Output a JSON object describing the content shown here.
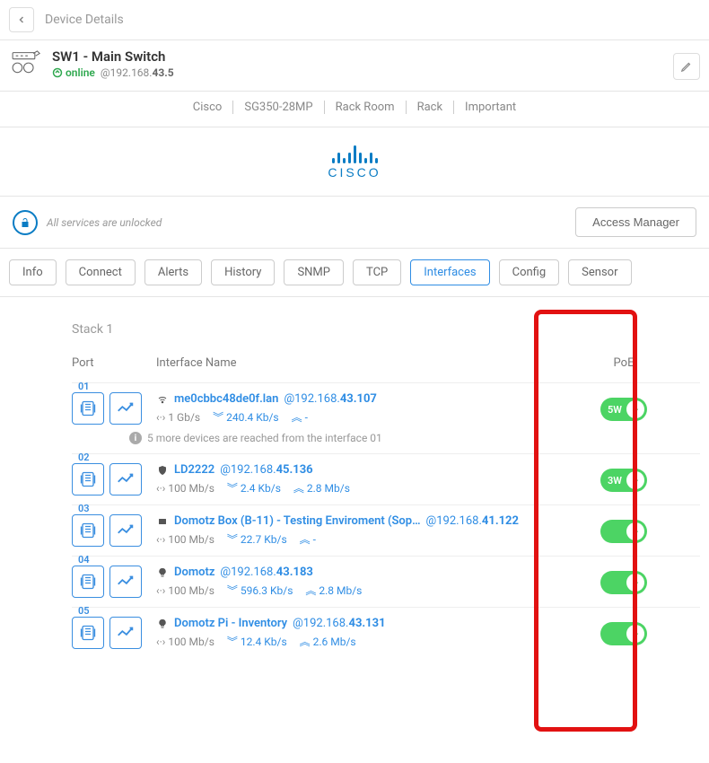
{
  "header": {
    "back": "‹",
    "title": "Device Details"
  },
  "device": {
    "name": "SW1 - Main Switch",
    "status": "online",
    "ip_prefix": "@192.168.",
    "ip_bold": "43.5"
  },
  "tags": [
    "Cisco",
    "SG350-28MP",
    "Rack Room",
    "Rack",
    "Important"
  ],
  "logo_text": "CISCO",
  "services": {
    "text": "All services are unlocked",
    "button": "Access Manager"
  },
  "tabs": [
    {
      "label": "Info",
      "active": false
    },
    {
      "label": "Connect",
      "active": false
    },
    {
      "label": "Alerts",
      "active": false
    },
    {
      "label": "History",
      "active": false
    },
    {
      "label": "SNMP",
      "active": false
    },
    {
      "label": "TCP",
      "active": false
    },
    {
      "label": "Interfaces",
      "active": true
    },
    {
      "label": "Config",
      "active": false
    },
    {
      "label": "Sensor",
      "active": false
    }
  ],
  "stack": {
    "title": "Stack 1",
    "columns": {
      "port": "Port",
      "name": "Interface Name",
      "poe": "PoE"
    },
    "ports": [
      {
        "num": "01",
        "icon": "wifi",
        "name": "me0cbbc48de0f.lan",
        "ip_prefix": "@192.168.",
        "ip_bold": "43.107",
        "speed": "1 Gb/s",
        "down": "240.4 Kb/s",
        "up": "-",
        "watt": "5W",
        "note": "5 more devices are reached from the interface 01"
      },
      {
        "num": "02",
        "icon": "shield",
        "name": "LD2222",
        "ip_prefix": "@192.168.",
        "ip_bold": "45.136",
        "speed": "100 Mb/s",
        "down": "2.4 Kb/s",
        "up": "2.8 Mb/s",
        "watt": "3W"
      },
      {
        "num": "03",
        "icon": "box",
        "name": "Domotz Box (B-11) - Testing Enviroment (Sop…",
        "ip_prefix": "@192.168.",
        "ip_bold": "41.122",
        "speed": "100 Mb/s",
        "down": "22.7 Kb/s",
        "up": "-",
        "watt": ""
      },
      {
        "num": "04",
        "icon": "bulb",
        "name": "Domotz",
        "ip_prefix": "@192.168.",
        "ip_bold": "43.183",
        "speed": "100 Mb/s",
        "down": "596.3 Kb/s",
        "up": "2.8 Mb/s",
        "watt": ""
      },
      {
        "num": "05",
        "icon": "bulb",
        "name": "Domotz Pi - Inventory",
        "ip_prefix": "@192.168.",
        "ip_bold": "43.131",
        "speed": "100 Mb/s",
        "down": "12.4 Kb/s",
        "up": "2.6 Mb/s",
        "watt": ""
      }
    ]
  }
}
